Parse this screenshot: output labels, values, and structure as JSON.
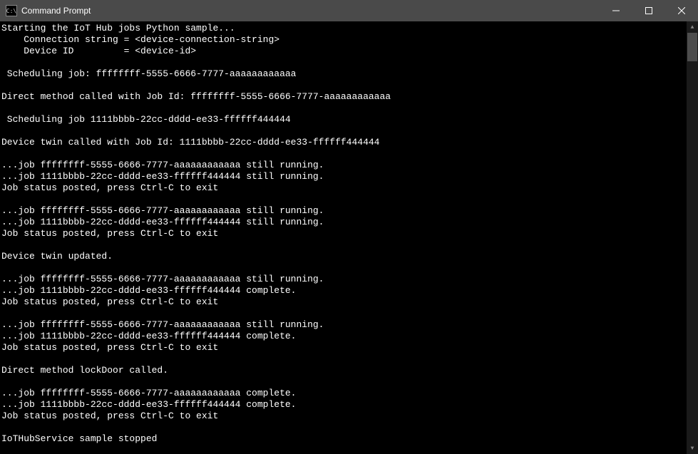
{
  "window": {
    "title": "Command Prompt",
    "icon_label": "C:\\"
  },
  "console": {
    "lines": [
      "Starting the IoT Hub jobs Python sample...",
      "    Connection string = <device-connection-string>",
      "    Device ID         = <device-id>",
      "",
      " Scheduling job: ffffffff-5555-6666-7777-aaaaaaaaaaaa",
      "",
      "Direct method called with Job Id: ffffffff-5555-6666-7777-aaaaaaaaaaaa",
      "",
      " Scheduling job 1111bbbb-22cc-dddd-ee33-ffffff444444",
      "",
      "Device twin called with Job Id: 1111bbbb-22cc-dddd-ee33-ffffff444444",
      "",
      "...job ffffffff-5555-6666-7777-aaaaaaaaaaaa still running.",
      "...job 1111bbbb-22cc-dddd-ee33-ffffff444444 still running.",
      "Job status posted, press Ctrl-C to exit",
      "",
      "...job ffffffff-5555-6666-7777-aaaaaaaaaaaa still running.",
      "...job 1111bbbb-22cc-dddd-ee33-ffffff444444 still running.",
      "Job status posted, press Ctrl-C to exit",
      "",
      "Device twin updated.",
      "",
      "...job ffffffff-5555-6666-7777-aaaaaaaaaaaa still running.",
      "...job 1111bbbb-22cc-dddd-ee33-ffffff444444 complete.",
      "Job status posted, press Ctrl-C to exit",
      "",
      "...job ffffffff-5555-6666-7777-aaaaaaaaaaaa still running.",
      "...job 1111bbbb-22cc-dddd-ee33-ffffff444444 complete.",
      "Job status posted, press Ctrl-C to exit",
      "",
      "Direct method lockDoor called.",
      "",
      "...job ffffffff-5555-6666-7777-aaaaaaaaaaaa complete.",
      "...job 1111bbbb-22cc-dddd-ee33-ffffff444444 complete.",
      "Job status posted, press Ctrl-C to exit",
      "",
      "IoTHubService sample stopped"
    ]
  }
}
